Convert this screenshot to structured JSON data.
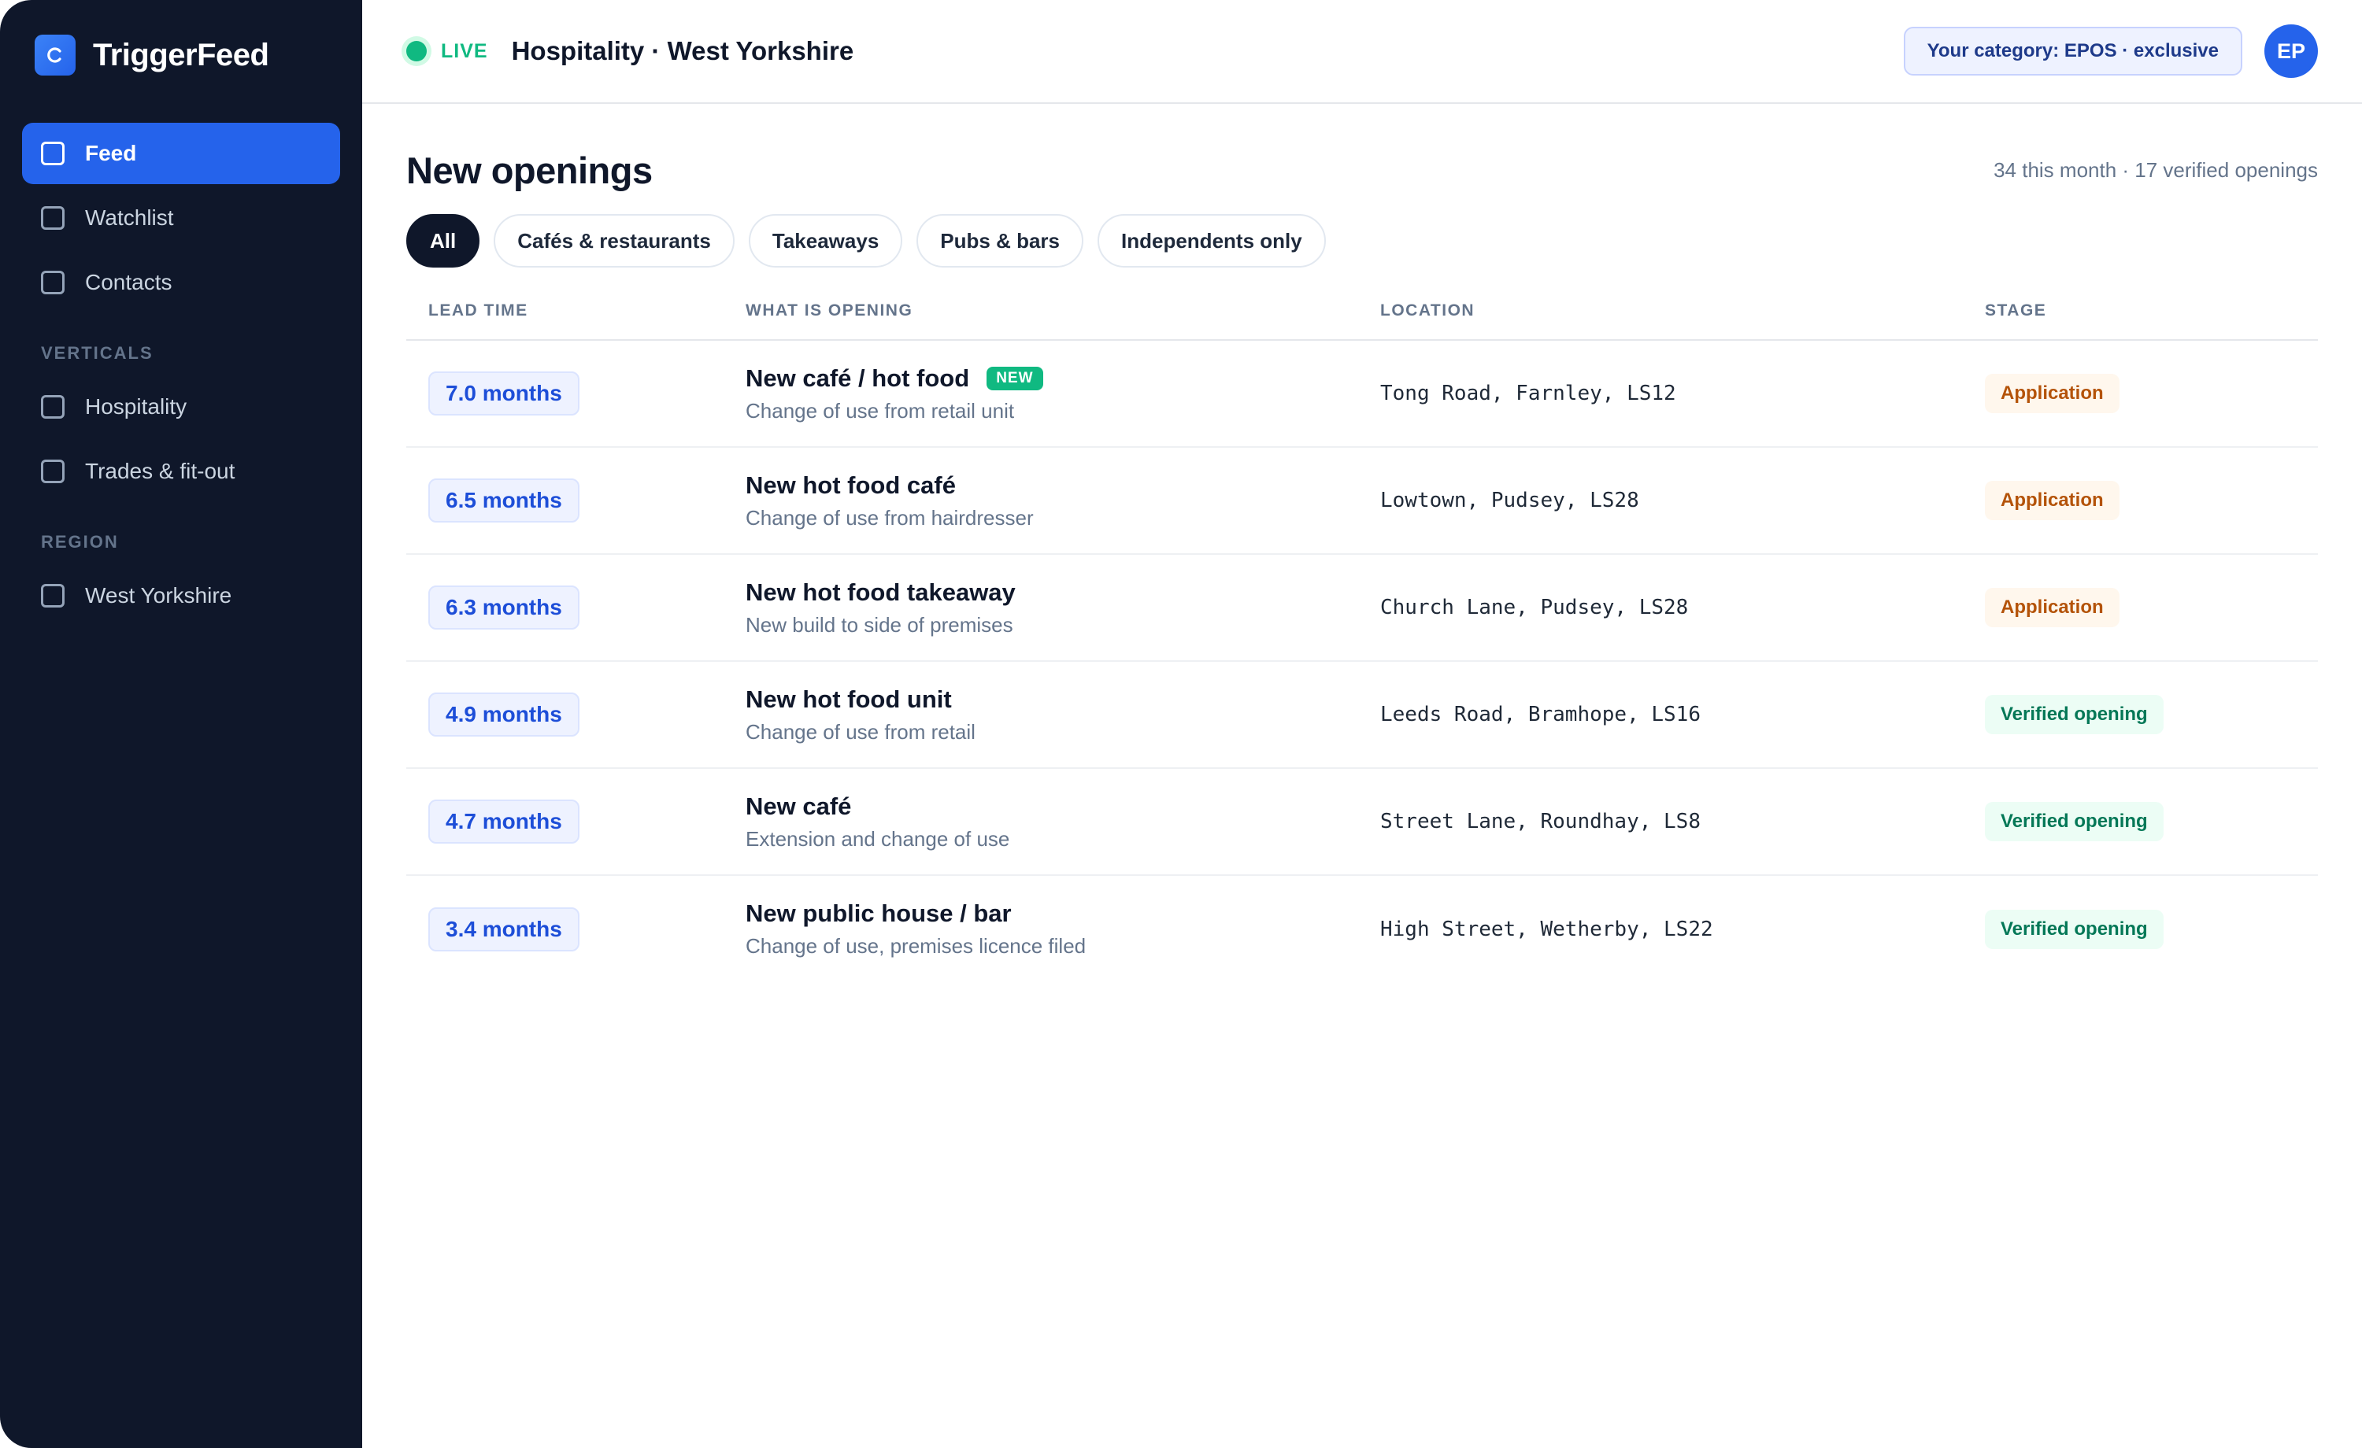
{
  "brand": {
    "name": "TriggerFeed",
    "icon": "trigger-logo-icon",
    "color": "#2563eb"
  },
  "sidebar": {
    "nav": [
      {
        "label": "Feed",
        "active": true,
        "icon": "square-icon"
      },
      {
        "label": "Watchlist",
        "active": false,
        "icon": "square-icon"
      },
      {
        "label": "Contacts",
        "active": false,
        "icon": "square-icon"
      }
    ],
    "verticals_heading": "VERTICALS",
    "verticals": [
      {
        "label": "Hospitality",
        "icon": "square-icon"
      },
      {
        "label": "Trades & fit-out",
        "icon": "square-icon"
      }
    ],
    "region_heading": "REGION",
    "regions": [
      {
        "label": "West Yorkshire",
        "icon": "square-icon"
      }
    ]
  },
  "header": {
    "live_label": "LIVE",
    "title": "Hospitality · West Yorkshire",
    "category_label": "Your category: EPOS · exclusive",
    "avatar_initials": "EP"
  },
  "main": {
    "title": "New openings",
    "summary": "34 this month · 17 verified openings",
    "filters": [
      {
        "label": "All",
        "active": true
      },
      {
        "label": "Cafés & restaurants",
        "active": false
      },
      {
        "label": "Takeaways",
        "active": false
      },
      {
        "label": "Pubs & bars",
        "active": false
      },
      {
        "label": "Independents only",
        "active": false
      }
    ],
    "columns": [
      "LEAD TIME",
      "WHAT IS OPENING",
      "LOCATION",
      "STAGE"
    ],
    "rows": [
      {
        "lead": "7.0 months",
        "title": "New café / hot food",
        "badge": "NEW",
        "sub": "Change of use from retail unit",
        "location": "Tong Road, Farnley, LS12",
        "stage": "Application",
        "stage_type": "application"
      },
      {
        "lead": "6.5 months",
        "title": "New hot food café",
        "badge": "",
        "sub": "Change of use from hairdresser",
        "location": "Lowtown, Pudsey, LS28",
        "stage": "Application",
        "stage_type": "application"
      },
      {
        "lead": "6.3 months",
        "title": "New hot food takeaway",
        "badge": "",
        "sub": "New build to side of premises",
        "location": "Church Lane, Pudsey, LS28",
        "stage": "Application",
        "stage_type": "application"
      },
      {
        "lead": "4.9 months",
        "title": "New hot food unit",
        "badge": "",
        "sub": "Change of use from retail",
        "location": "Leeds Road, Bramhope, LS16",
        "stage": "Verified opening",
        "stage_type": "verified"
      },
      {
        "lead": "4.7 months",
        "title": "New café",
        "badge": "",
        "sub": "Extension and change of use",
        "location": "Street Lane, Roundhay, LS8",
        "stage": "Verified opening",
        "stage_type": "verified"
      },
      {
        "lead": "3.4 months",
        "title": "New public house / bar",
        "badge": "",
        "sub": "Change of use, premises licence filed",
        "location": "High Street, Wetherby, LS22",
        "stage": "Verified opening",
        "stage_type": "verified"
      }
    ]
  },
  "colors": {
    "sidebar_bg": "#0f172a",
    "accent": "#2563eb",
    "live": "#10b981",
    "stage_application": "#b45309",
    "stage_verified": "#047857"
  }
}
